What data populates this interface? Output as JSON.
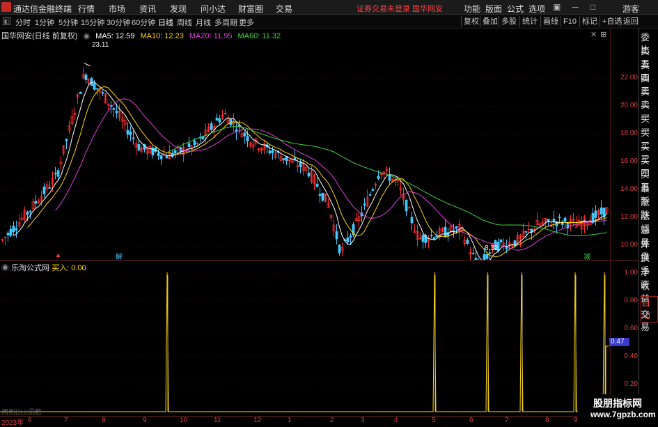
{
  "app_title": "通达信金融终端",
  "menu": [
    "行情",
    "市场",
    "资讯",
    "发现",
    "问小达",
    "财富圈",
    "交易"
  ],
  "warning": "证券交易未登录  国华网安",
  "menu_right": [
    "功能",
    "版面",
    "公式",
    "选项"
  ],
  "user": "游客",
  "periods": [
    "分时",
    "1分钟",
    "5分钟",
    "15分钟",
    "30分钟",
    "60分钟",
    "日线",
    "周线",
    "月线",
    "多周期",
    "更多"
  ],
  "active_period": "日线",
  "toolbar_right": [
    "复权",
    "叠加",
    "多股",
    "统计",
    "画线",
    "F10",
    "标记",
    "+自选",
    "返回"
  ],
  "stock_title": "国华网安(日线 前复权)",
  "ma": [
    {
      "label": "MA5: 12.59",
      "color": "#ffffff"
    },
    {
      "label": "MA10: 12.23",
      "color": "#ffd700"
    },
    {
      "label": "MA20: 11.95",
      "color": "#e040e0"
    },
    {
      "label": "MA60: 11.32",
      "color": "#40d040"
    }
  ],
  "price_ticks": [
    "22.00",
    "20.00",
    "18.00",
    "16.00",
    "14.00",
    "12.00",
    "10.00"
  ],
  "high_label": "23.11",
  "low_label": "8.32",
  "indicator_title": "乐淘公式网",
  "indicator_value": "买入: 0.00",
  "indicator_ticks": [
    "1.00",
    "0.80",
    "0.60",
    "0.40",
    "0.20"
  ],
  "indicator_current": "0.47",
  "dll_text": "用到DLL函数",
  "x_labels": [
    "2023年",
    "6",
    "7",
    "8",
    "9",
    "10",
    "11",
    "12",
    "1",
    "2",
    "3",
    "4",
    "5",
    "6",
    "7",
    "8",
    "9"
  ],
  "right_panel": [
    "委比",
    "卖五",
    "卖四",
    "卖三",
    "卖二",
    "卖一",
    "买一",
    "买二",
    "买三",
    "买四",
    "买五",
    "最新",
    "涨跌",
    "涨幅",
    "总量",
    "外盘",
    "换手",
    "净资",
    "收益"
  ],
  "right_bottom": [
    "自动",
    "交易"
  ],
  "markers": {
    "jie": "解",
    "jian": "减"
  },
  "watermark": [
    "股朋指标网",
    "www.7gpzb.com"
  ],
  "signals": [
    0.0,
    1,
    0,
    0,
    0,
    0,
    1,
    1,
    1,
    1,
    1
  ]
}
